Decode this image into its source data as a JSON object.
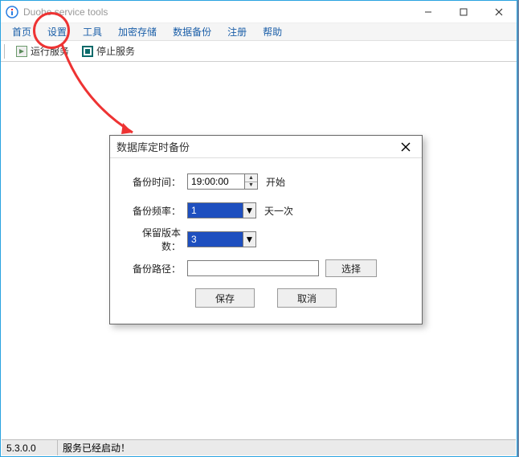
{
  "window": {
    "title": "Duohe service tools"
  },
  "menu": {
    "items": [
      "首页",
      "设置",
      "工具",
      "加密存储",
      "数据备份",
      "注册",
      "帮助"
    ]
  },
  "toolbar": {
    "run_label": "运行服务",
    "stop_label": "停止服务"
  },
  "status": {
    "version": "5.3.0.0",
    "message": "服务已经启动！"
  },
  "dialog": {
    "title": "数据库定时备份",
    "labels": {
      "time": "备份时间：",
      "freq": "备份频率：",
      "keep": "保留版本数：",
      "path": "备份路径："
    },
    "time_value": "19:00:00",
    "time_suffix": "开始",
    "freq_value": "1",
    "freq_suffix": "天一次",
    "keep_value": "3",
    "path_value": "",
    "browse": "选择",
    "save": "保存",
    "cancel": "取消"
  }
}
